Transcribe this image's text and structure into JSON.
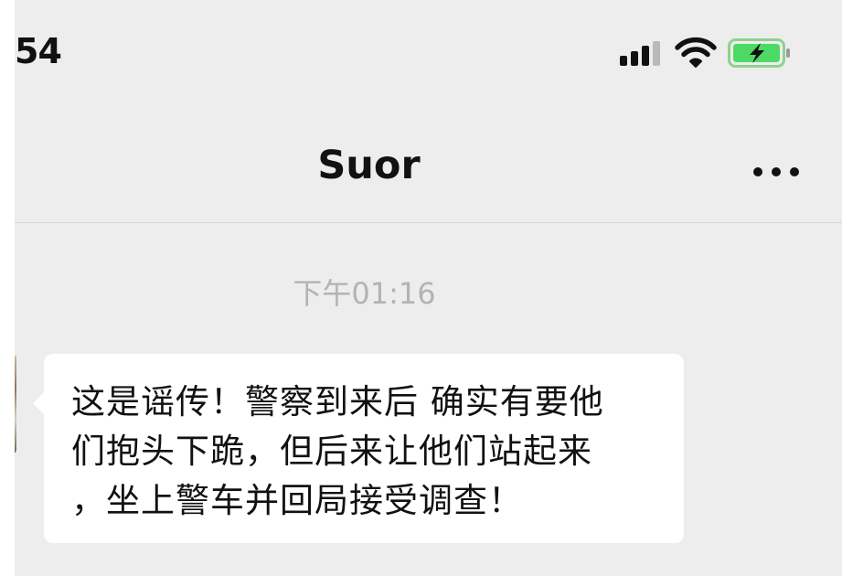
{
  "status_bar": {
    "time": "54",
    "icons": [
      "cellular-signal-icon",
      "wifi-icon",
      "battery-charging-icon"
    ],
    "battery_color": "#4cd964"
  },
  "nav": {
    "title": "Suor",
    "more_icon": "more-dots-icon"
  },
  "chat": {
    "timestamp": "下午01:16",
    "message": {
      "lines": [
        "这是谣传！警察到来后 确实有要他",
        "们抱头下跪，但后来让他们站起来",
        "，坐上警车并回局接受调查！"
      ]
    }
  },
  "colors": {
    "background": "#ededed",
    "bubble": "#ffffff",
    "timestamp": "#b3b3b3"
  }
}
